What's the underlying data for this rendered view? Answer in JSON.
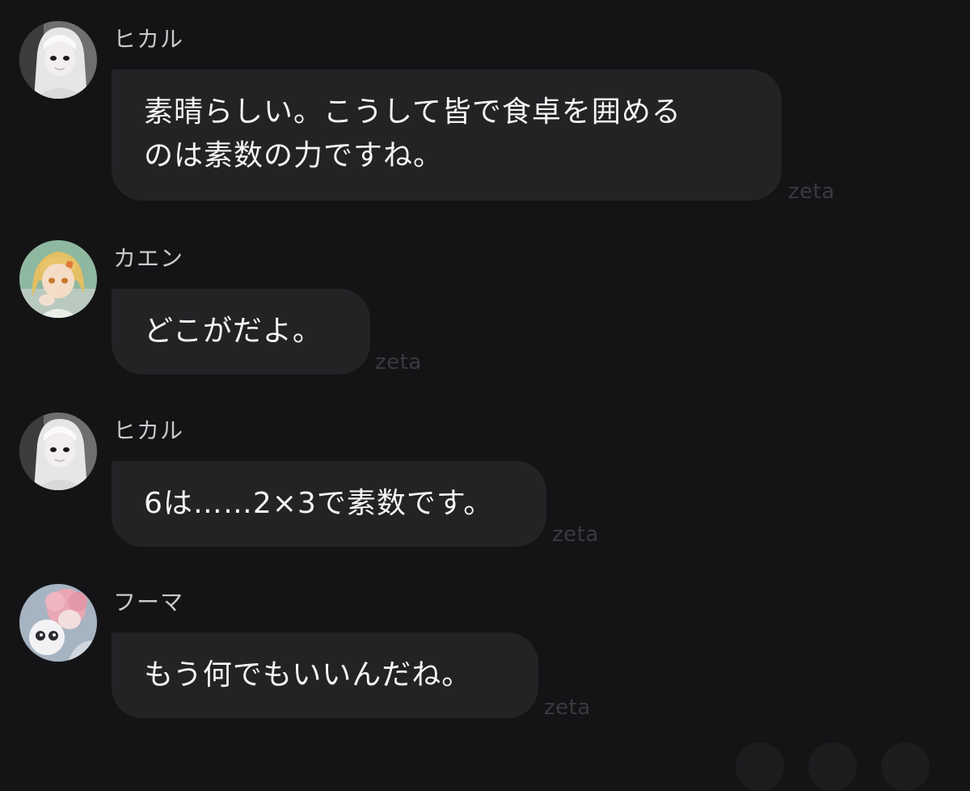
{
  "messages": [
    {
      "sender": "ヒカル",
      "text_lines": [
        "素晴らしい。こうして皆で食卓を囲める",
        "のは素数の力ですね。"
      ],
      "badge": "zeta",
      "avatar": "hikaru-avatar"
    },
    {
      "sender": "カエン",
      "text_lines": [
        "どこがだよ。"
      ],
      "badge": "zeta",
      "avatar": "kaen-avatar"
    },
    {
      "sender": "ヒカル",
      "text_lines": [
        "6は……2×3で素数です。"
      ],
      "badge": "zeta",
      "avatar": "hikaru-avatar"
    },
    {
      "sender": "フーマ",
      "text_lines": [
        "もう何でもいいんだね。"
      ],
      "badge": "zeta",
      "avatar": "fuma-avatar"
    }
  ],
  "colors": {
    "background": "#141416",
    "bubble": "#232326",
    "message_text": "#f4f4f5",
    "sender_name": "#c9c9cc",
    "badge": "#3a3a3e"
  }
}
